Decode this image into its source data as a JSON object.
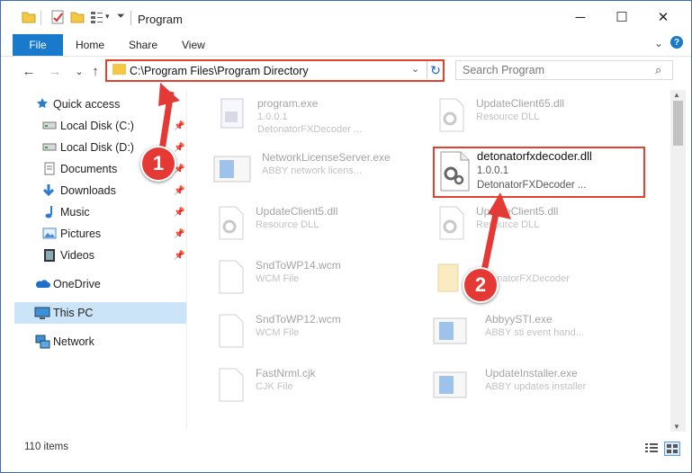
{
  "window": {
    "title": "Program",
    "minimize_glyph": "─",
    "maximize_glyph": "☐",
    "close_glyph": "✕"
  },
  "ribbon": {
    "tabs": [
      "File",
      "Home",
      "Share",
      "View"
    ],
    "help_glyph": "?",
    "collapse_glyph": "⌄"
  },
  "navigation": {
    "back_glyph": "←",
    "forward_glyph": "→",
    "recent_glyph": "⌄",
    "up_glyph": "↑"
  },
  "address_bar": {
    "path": "C:\\Program Files\\Program Directory",
    "dropdown_glyph": "⌄",
    "refresh_glyph": "↻"
  },
  "search": {
    "placeholder": "Search Program",
    "icon_glyph": "⌕"
  },
  "sidebar": {
    "items": [
      {
        "label": "Quick access",
        "icon": "star-icon"
      },
      {
        "label": "Local Disk (C:)",
        "icon": "drive-icon",
        "pinned": true
      },
      {
        "label": "Local Disk (D:)",
        "icon": "drive-icon",
        "pinned": true
      },
      {
        "label": "Documents",
        "icon": "documents-icon",
        "pinned": true
      },
      {
        "label": "Downloads",
        "icon": "downloads-icon",
        "pinned": true
      },
      {
        "label": "Music",
        "icon": "music-icon",
        "pinned": true
      },
      {
        "label": "Pictures",
        "icon": "pictures-icon",
        "pinned": true
      },
      {
        "label": "Videos",
        "icon": "videos-icon",
        "pinned": true
      },
      {
        "label": "OneDrive",
        "icon": "cloud-icon"
      },
      {
        "label": "This PC",
        "icon": "computer-icon",
        "selected": true
      },
      {
        "label": "Network",
        "icon": "network-icon"
      }
    ],
    "pin_glyph": "📌"
  },
  "files": [
    {
      "name": "program.exe",
      "line2": "1.0.0.1",
      "line3": "DetonatorFXDecoder ...",
      "icon": "exe-icon"
    },
    {
      "name": "UpdateClient65.dll",
      "line2": "Resource DLL",
      "line3": "",
      "icon": "dll-icon"
    },
    {
      "name": "NetworkLicenseServer.exe",
      "line2": "ABBY network licens...",
      "line3": "",
      "icon": "app-icon"
    },
    {
      "name": "detonatorfxdecoder.dll",
      "line2": "1.0.0.1",
      "line3": "DetonatorFXDecoder ...",
      "icon": "dll-icon",
      "highlighted": true
    },
    {
      "name": "UpdateClient5.dll",
      "line2": "Resource DLL",
      "line3": "",
      "icon": "dll-icon"
    },
    {
      "name": "UpdateClient5.dll",
      "line2": "Resource DLL",
      "line3": "",
      "icon": "dll-icon"
    },
    {
      "name": "SndToWP14.wcm",
      "line2": "WCM File",
      "line3": "",
      "icon": "file-icon"
    },
    {
      "name": "...",
      "line2": "DetonatorFXDecoder",
      "line3": "",
      "icon": "folder-icon"
    },
    {
      "name": "SndToWP12.wcm",
      "line2": "WCM File",
      "line3": "",
      "icon": "file-icon"
    },
    {
      "name": "AbbyySTI.exe",
      "line2": "ABBY sti event hand...",
      "line3": "",
      "icon": "app-icon"
    },
    {
      "name": "FastNrml.cjk",
      "line2": "CJK File",
      "line3": "",
      "icon": "file-icon"
    },
    {
      "name": "UpdateInstaller.exe",
      "line2": "ABBY updates installer",
      "line3": "",
      "icon": "app-icon"
    }
  ],
  "status_bar": {
    "item_count": "110 items"
  },
  "annotations": {
    "step1": "1",
    "step2": "2"
  },
  "colors": {
    "accent": "#1979ca",
    "highlight": "#e2412d",
    "selection": "#cce4f7",
    "badge": "#e53935"
  }
}
